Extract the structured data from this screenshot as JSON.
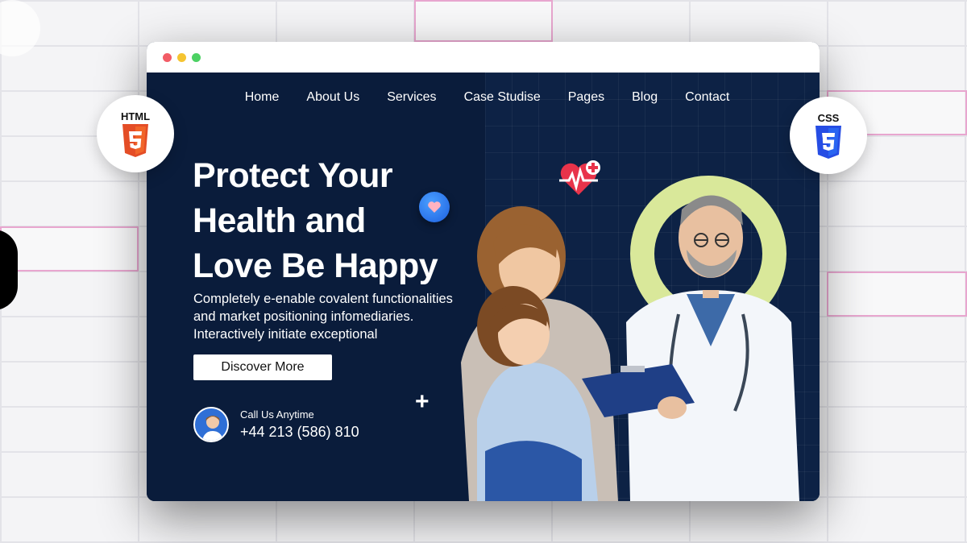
{
  "nav": {
    "items": [
      "Home",
      "About Us",
      "Services",
      "Case Studise",
      "Pages",
      "Blog",
      "Contact"
    ]
  },
  "hero": {
    "headline": [
      "Protect Your",
      "Health and",
      "Love Be Happy"
    ],
    "subtext": [
      "Completely e-enable covalent functionalities",
      "and market positioning infomediaries.",
      "Interactively initiate exceptional"
    ],
    "cta_label": "Discover More",
    "call_label": "Call Us Anytime",
    "phone": "+44 213 (586) 810"
  },
  "badges": {
    "html_label": "HTML",
    "css_label": "CSS"
  },
  "colors": {
    "hero_bg": "#0a1c3b",
    "ring": "#d9e89a",
    "html_orange": "#e44d26",
    "css_blue": "#264de4"
  }
}
